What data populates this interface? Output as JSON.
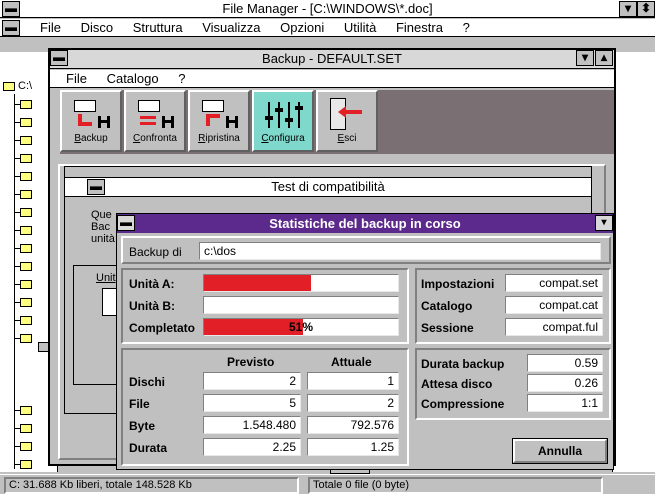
{
  "file_manager": {
    "title": "File Manager - [C:\\WINDOWS\\*.doc]",
    "menu": [
      "File",
      "Disco",
      "Struttura",
      "Visualizza",
      "Opzioni",
      "Utilità",
      "Finestra",
      "?"
    ],
    "drive_label": "C:\\",
    "status_left": "C: 31.688 Kb liberi, totale 148.528 Kb",
    "status_right": "Totale 0 file (0 byte)"
  },
  "backup_window": {
    "title": "Backup - DEFAULT.SET",
    "menu": [
      "File",
      "Catalogo",
      "?"
    ],
    "toolbar": [
      {
        "label": "Backup",
        "icon": "backup-icon"
      },
      {
        "label": "Confronta",
        "icon": "compare-icon"
      },
      {
        "label": "Ripristina",
        "icon": "restore-icon"
      },
      {
        "label": "Configura",
        "icon": "configure-icon"
      },
      {
        "label": "Esci",
        "icon": "exit-icon"
      }
    ]
  },
  "compat_dialog": {
    "title": "Test di compatibilità",
    "text_lines": [
      "Que",
      "Bac",
      "unità"
    ],
    "unit_label": "Unit"
  },
  "stats_dialog": {
    "title": "Statistiche del backup in corso",
    "backup_di_label": "Backup di",
    "backup_di_value": "c:\\dos",
    "unita_a_label": "Unità A:",
    "unita_b_label": "Unità B:",
    "completato_label": "Completato",
    "unita_a_progress": 0.55,
    "unita_b_progress": 0,
    "completato_progress": 0.51,
    "completato_text": "51%",
    "impostazioni_label": "Impostazioni",
    "impostazioni_value": "compat.set",
    "catalogo_label": "Catalogo",
    "catalogo_value": "compat.cat",
    "sessione_label": "Sessione",
    "sessione_value": "compat.ful",
    "col_previsto": "Previsto",
    "col_attuale": "Attuale",
    "rows": [
      {
        "label": "Dischi",
        "previsto": "2",
        "attuale": "1"
      },
      {
        "label": "File",
        "previsto": "5",
        "attuale": "2"
      },
      {
        "label": "Byte",
        "previsto": "1.548.480",
        "attuale": "792.576"
      },
      {
        "label": "Durata",
        "previsto": "2.25",
        "attuale": "1.25"
      }
    ],
    "durata_backup_label": "Durata backup",
    "durata_backup_value": "0.59",
    "attesa_disco_label": "Attesa disco",
    "attesa_disco_value": "0.26",
    "compressione_label": "Compressione",
    "compressione_value": "1:1",
    "annulla_label": "Annulla"
  },
  "colors": {
    "stats_titlebar": "#5c2a8c",
    "progress_fill": "#e21f26",
    "configure_bg": "#7fd8cc",
    "toolbar_bg": "#7a6f72"
  }
}
